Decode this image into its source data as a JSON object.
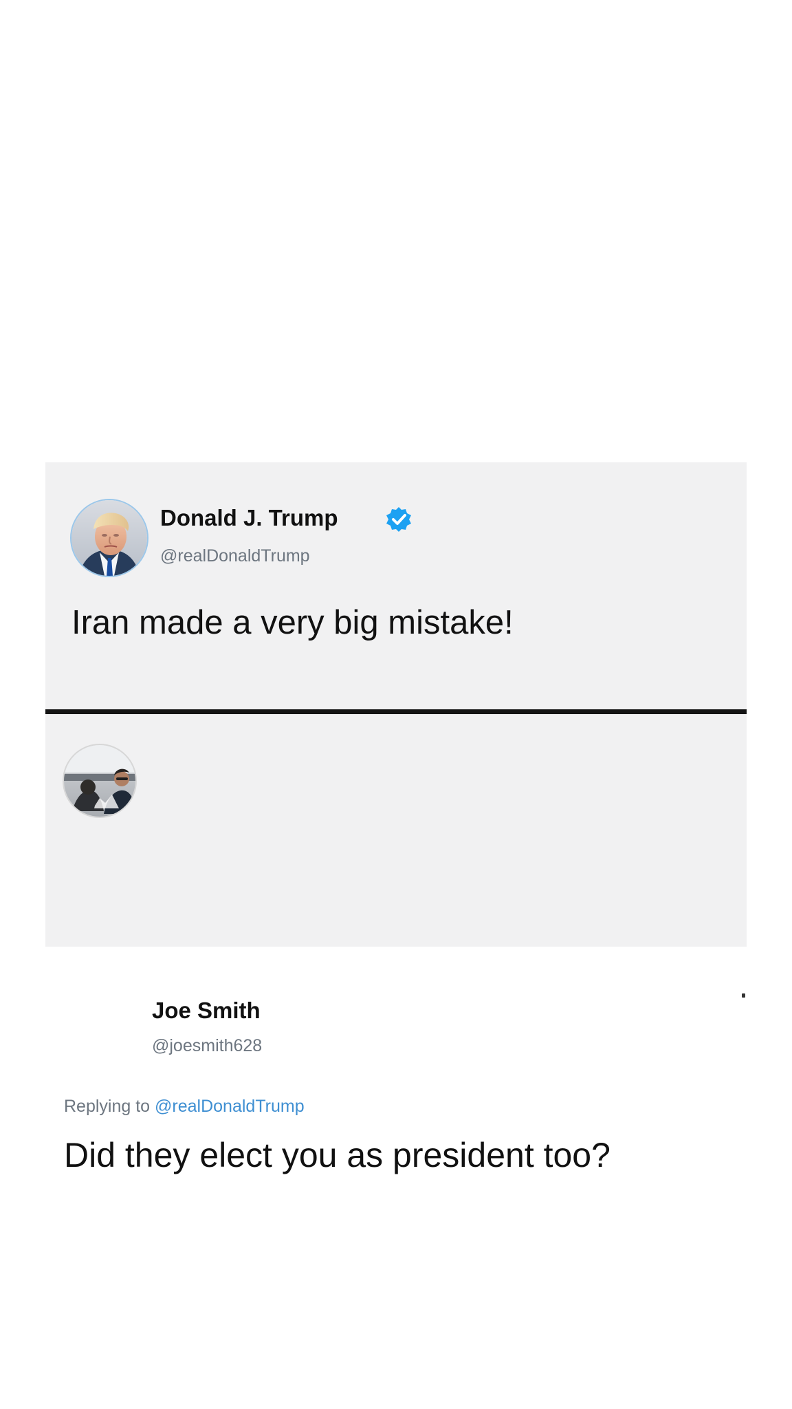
{
  "tweet": {
    "author_name": "Donald J. Trump",
    "author_handle": "@realDonaldTrump",
    "text": "Iran made a very big mistake!",
    "verified_icon": "verified-badge-icon",
    "avatar_icon": "trump-avatar"
  },
  "reply": {
    "author_name": "Joe Smith",
    "author_handle": "@joesmith628",
    "replying_to_label": "Replying to",
    "replying_to_handle": "@realDonaldTrump",
    "text": "Did they elect you as president too?",
    "avatar_icon": "joe-avatar"
  },
  "colors": {
    "card_background": "#f1f1f2",
    "divider": "#141414",
    "handle_text": "#6d7680",
    "link": "#3f8fd2",
    "verified_badge": "#1da1f2"
  }
}
